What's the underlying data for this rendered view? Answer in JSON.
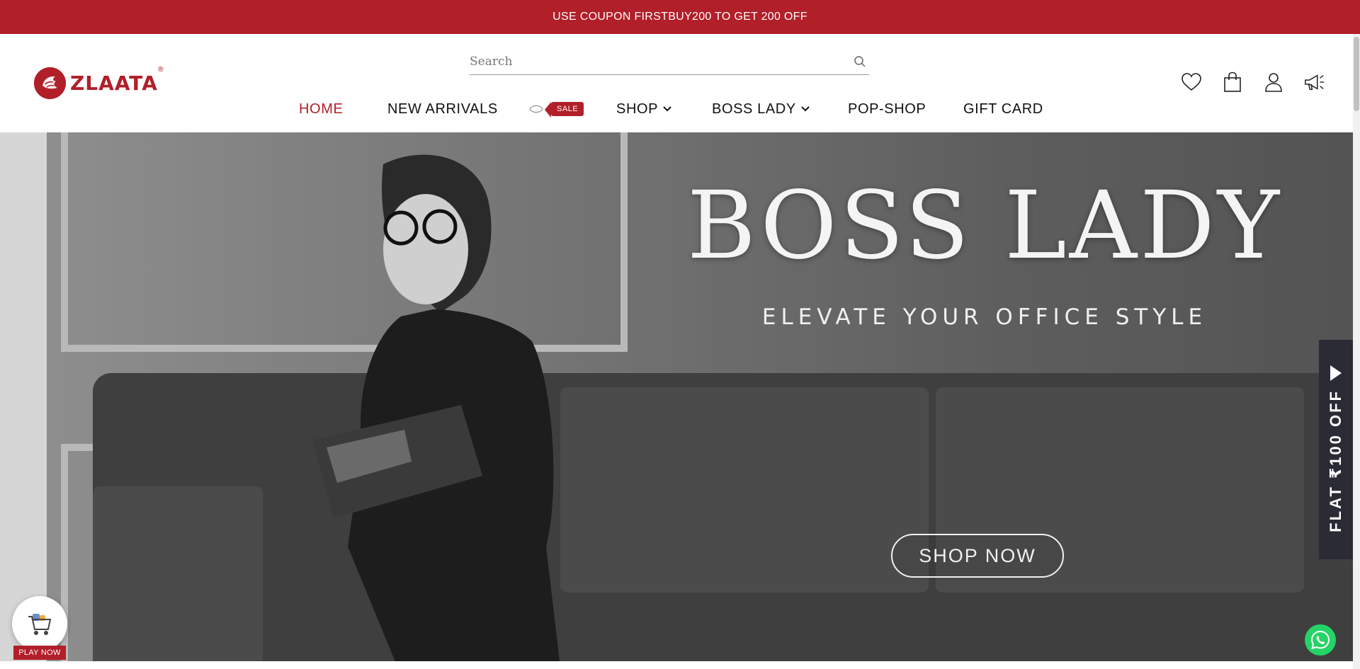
{
  "announcement": {
    "text": "USE COUPON FIRSTBUY200 TO GET 200 OFF"
  },
  "brand": {
    "name": "ZLAATA",
    "registered_mark": "®",
    "accent_color": "#b11f29"
  },
  "search": {
    "placeholder": "Search"
  },
  "nav": {
    "items": [
      {
        "label": "HOME",
        "active": true
      },
      {
        "label": "NEW ARRIVALS"
      },
      {
        "label": "SALE",
        "tag": true
      },
      {
        "label": "SHOP",
        "dropdown": true
      },
      {
        "label": "BOSS LADY",
        "dropdown": true
      },
      {
        "label": "POP-SHOP"
      },
      {
        "label": "GIFT CARD"
      }
    ]
  },
  "header_icons": [
    "heart-icon",
    "bag-icon",
    "user-icon",
    "megaphone-icon"
  ],
  "hero": {
    "title": "BOSS LADY",
    "subtitle": "ELEVATE YOUR OFFICE STYLE",
    "cta_label": "SHOP NOW"
  },
  "side_promo": {
    "text": "FLAT ₹100 OFF"
  },
  "play_widget": {
    "label": "PLAY NOW"
  }
}
